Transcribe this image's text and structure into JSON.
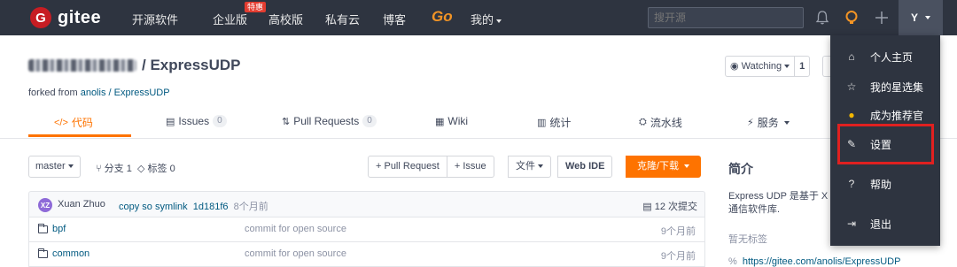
{
  "topbar": {
    "brand": "gitee",
    "brand_mark": "G",
    "nav": [
      "开源软件",
      "企业版",
      "高校版",
      "私有云",
      "博客"
    ],
    "nav_badge": "特惠",
    "go_label": "Go",
    "mine_label": "我的",
    "search_placeholder": "搜开源",
    "avatar_letter": "Y",
    "icons": [
      "bell-icon",
      "lightbulb-icon",
      "plus-icon"
    ]
  },
  "repo": {
    "name": "/ ExpressUDP",
    "forked_prefix": "forked from",
    "forked_link": "anolis / ExpressUDP",
    "watch_label": "Watching",
    "watch_count": "1"
  },
  "tabs": [
    {
      "icon": "</>",
      "label": "代码"
    },
    {
      "icon": "▤",
      "label": "Issues",
      "count": "0"
    },
    {
      "icon": "⇅",
      "label": "Pull Requests",
      "count": "0"
    },
    {
      "icon": "▦",
      "label": "Wiki"
    },
    {
      "icon": "▥",
      "label": "统计"
    },
    {
      "icon": "⛭",
      "label": "流水线"
    },
    {
      "icon": "⚡",
      "label": "服务"
    }
  ],
  "toolbar": {
    "branch": "master",
    "branch_count": "分支 1",
    "tag_count": "标签 0",
    "pull_request": "+ Pull Request",
    "issue": "+ Issue",
    "file_menu": "文件",
    "web_ide": "Web IDE",
    "clone": "克隆/下载"
  },
  "commit": {
    "avatar_initials": "XZ",
    "author": "Xuan Zhuo",
    "message": "copy so symlink",
    "hash": "1d181f6",
    "time": "8个月前",
    "total": "12 次提交"
  },
  "files": [
    {
      "name": "bpf",
      "commit": "commit for open source",
      "time": "9个月前"
    },
    {
      "name": "common",
      "commit": "commit for open source",
      "time": "9个月前"
    }
  ],
  "side": {
    "title": "简介",
    "desc_line1": "Express UDP 是基于 X",
    "desc_line2": "通信软件库.",
    "notag": "暂无标签",
    "link": "https://gitee.com/anolis/ExpressUDP"
  },
  "dropdown": {
    "items": [
      {
        "icon": "⌂",
        "label": "个人主页"
      },
      {
        "icon": "☆",
        "label": "我的星选集"
      },
      {
        "icon": "●",
        "label": "成为推荐官"
      },
      {
        "icon": "✎",
        "label": "设置"
      },
      {
        "icon": "?",
        "label": "帮助"
      },
      {
        "icon": "⇥",
        "label": "退出"
      }
    ],
    "highlight_color": "#e02020"
  },
  "colors": {
    "accent": "#fe7300",
    "navbar": "#2e3440",
    "link": "#005980",
    "brand": "#c71d23"
  }
}
